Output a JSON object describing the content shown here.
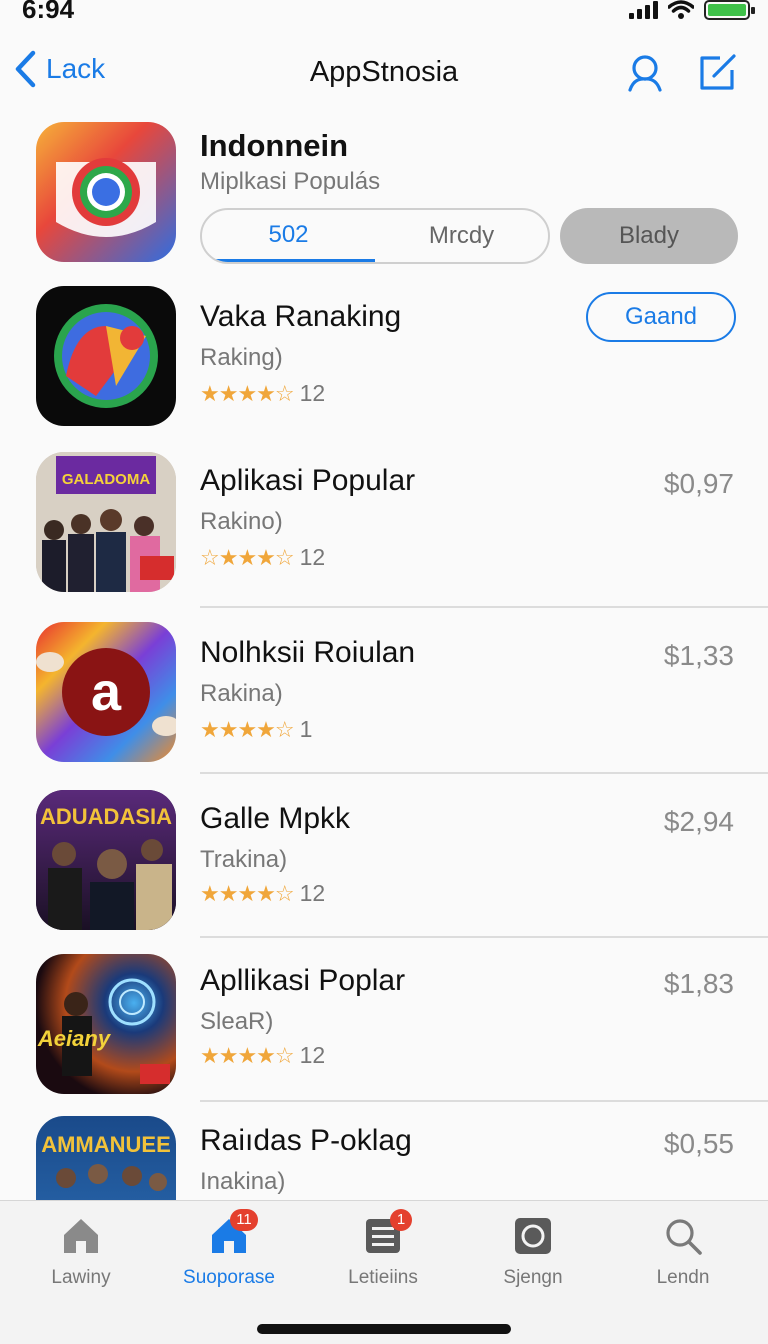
{
  "status": {
    "time": "6:94"
  },
  "nav": {
    "back_label": "Lack",
    "title": "AppStnosia"
  },
  "featured": {
    "name": "Indonnein",
    "subtitle": "Miplkasi Populás",
    "segments": [
      "502",
      "Mrcdy"
    ],
    "grey_button": "Blady"
  },
  "apps": [
    {
      "name": "Vaka Ranaking",
      "sub": "Raking)",
      "stars": "★★★★☆",
      "count": "12",
      "action": "Gaand",
      "price": ""
    },
    {
      "name": "Aplikasi Popular",
      "sub": "Rakino)",
      "stars": "☆★★★☆",
      "count": "12",
      "price": "$0,97"
    },
    {
      "name": "Nolhksii Roiulan",
      "sub": "Rakina)",
      "stars": "★★★★☆",
      "count": "1",
      "price": "$1,33"
    },
    {
      "name": "Galle Mpkk",
      "sub": "Trakina)",
      "stars": "★★★★☆",
      "count": "12",
      "price": "$2,94"
    },
    {
      "name": "Apllikasi Poplar",
      "sub": "SleaR)",
      "stars": "★★★★☆",
      "count": "12",
      "price": "$1,83"
    },
    {
      "name": "Raiıdas P-oklag",
      "sub": "Inakina)",
      "stars": "",
      "count": "",
      "price": "$0,55"
    }
  ],
  "icon_labels": {
    "app3": "GALADOMA",
    "app5": "ADUADASIA",
    "app6": "Aeiany",
    "app7": "AMMANUEE"
  },
  "tabs": [
    {
      "label": "Lawiny",
      "icon": "house-icon",
      "badge": ""
    },
    {
      "label": "Suoporase",
      "icon": "house-icon",
      "badge": "11"
    },
    {
      "label": "Letieiins",
      "icon": "list-icon",
      "badge": "1"
    },
    {
      "label": "Sjengn",
      "icon": "camera-icon",
      "badge": ""
    },
    {
      "label": "Lendn",
      "icon": "search-icon",
      "badge": ""
    }
  ],
  "colors": {
    "accent": "#1a7be6",
    "star": "#f0a63a",
    "badge": "#e4402e"
  }
}
